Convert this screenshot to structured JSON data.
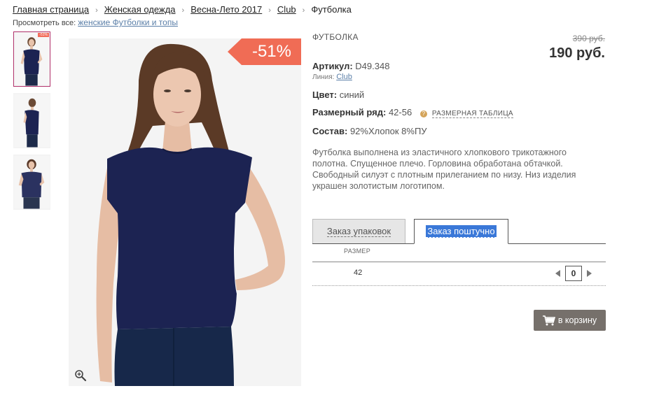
{
  "breadcrumb": {
    "items": [
      "Главная страница",
      "Женская одежда",
      "Весна-Лето 2017",
      "Club"
    ],
    "current": "Футболка",
    "separator": "›"
  },
  "view_all": {
    "label": "Просмотреть все:",
    "link": "женские Футболки и топы"
  },
  "thumbnails": {
    "badge": "-51%"
  },
  "main_image": {
    "discount_badge": "-51%",
    "zoom_icon": "magnifier-plus-icon"
  },
  "product": {
    "title": "ФУТБОЛКА",
    "old_price": "390 руб.",
    "price": "190 руб.",
    "article_label": "Артикул:",
    "article_value": "D49.348",
    "line_label": "Линия:",
    "line_value": "Club",
    "color_label": "Цвет:",
    "color_value": "синий",
    "sizes_label": "Размерный ряд:",
    "sizes_value": "42-56",
    "size_table_link": "РАЗМЕРНАЯ ТАБЛИЦА",
    "help_icon": "?",
    "composition_label": "Состав:",
    "composition_value": "92%Хлопок 8%ПУ",
    "description": "Футболка выполнена из эластичного  хлопкового трикотажного полотна. Спущенное плечо. Горловина обработана обтачкой. Свободный силуэт с плотным прилеганием по низу. Низ изделия украшен золотистым логотипом."
  },
  "order": {
    "tabs": [
      "Заказ упаковок",
      "Заказ поштучно"
    ],
    "active_tab": 1,
    "size_header": "РАЗМЕР",
    "rows": [
      {
        "size": "42",
        "quantity": "0"
      }
    ],
    "cart_button": "в корзину"
  },
  "colors": {
    "discount": "#f06c55",
    "shirt": "#1c2352",
    "cart_button": "#76706b",
    "active_thumb_border": "#b0306a",
    "link": "#5b7fa8",
    "selection": "#3a78d8"
  }
}
